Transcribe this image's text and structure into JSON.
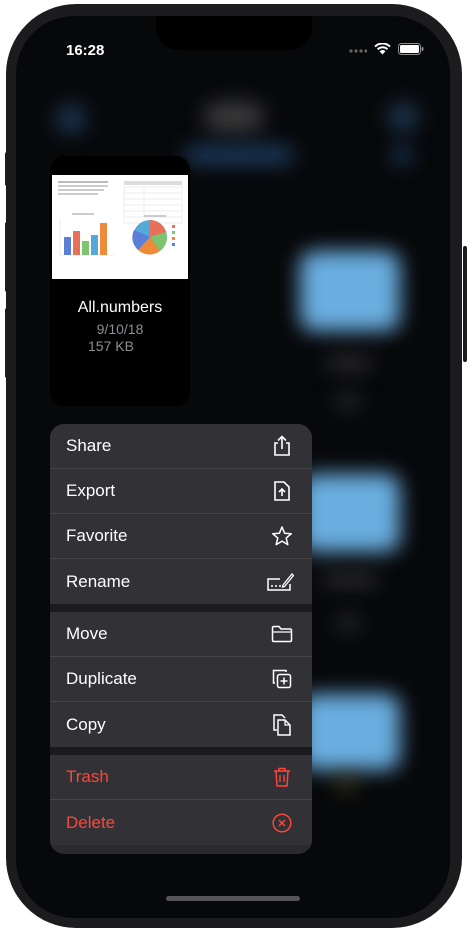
{
  "status_bar": {
    "time": "16:28"
  },
  "file": {
    "name": "All.numbers",
    "date": "9/10/18",
    "size": "157 KB"
  },
  "menu": {
    "group1": [
      {
        "label": "Share",
        "icon": "share-icon"
      },
      {
        "label": "Export",
        "icon": "export-icon"
      },
      {
        "label": "Favorite",
        "icon": "star-icon"
      },
      {
        "label": "Rename",
        "icon": "rename-icon"
      }
    ],
    "group2": [
      {
        "label": "Move",
        "icon": "folder-icon"
      },
      {
        "label": "Duplicate",
        "icon": "duplicate-icon"
      },
      {
        "label": "Copy",
        "icon": "copy-icon"
      }
    ],
    "group3": [
      {
        "label": "Trash",
        "icon": "trash-icon"
      },
      {
        "label": "Delete",
        "icon": "delete-icon"
      }
    ]
  },
  "colors": {
    "danger": "#ff453a",
    "folder": "#6aaee0"
  }
}
